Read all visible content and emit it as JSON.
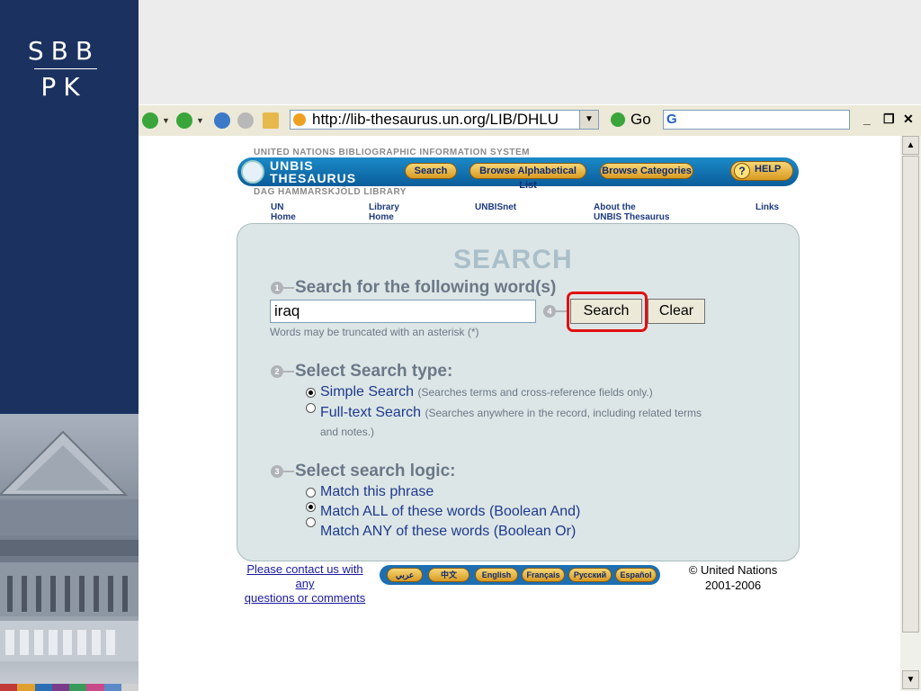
{
  "sidebar": {
    "logo_top": "SBB",
    "logo_bottom": "PK",
    "strip_colors": [
      "#c23b3b",
      "#e0a030",
      "#2b6fb3",
      "#7a3c8a",
      "#3a9a5a",
      "#c84a8a",
      "#5a8ac8",
      "#d0d0d0"
    ]
  },
  "browser": {
    "address": "http://lib-thesaurus.un.org/LIB/DHLU",
    "go_label": "Go",
    "search_value": ""
  },
  "unbis": {
    "system_label": "UNITED NATIONS BIBLIOGRAPHIC INFORMATION SYSTEM",
    "title_line1": "UNBIS",
    "title_line2": "THESAURUS",
    "library_label": "DAG HAMMARSKJÖLD LIBRARY",
    "buttons": {
      "search": "Search",
      "browse_alpha": "Browse Alphabetical List",
      "browse_cat": "Browse Categories",
      "help": "HELP"
    },
    "nav": {
      "un_home_1": "UN",
      "un_home_2": "Home",
      "lib_home_1": "Library",
      "lib_home_2": "Home",
      "unbisnet": "UNBISnet",
      "about_1": "About the",
      "about_2": "UNBIS Thesaurus",
      "links": "Links"
    }
  },
  "search": {
    "heading": "SEARCH",
    "step1_num": "1",
    "step1_title": "Search for the following word(s)",
    "query": "iraq",
    "step4_num": "4",
    "search_button": "Search",
    "clear_button": "Clear",
    "trunc_hint": "Words may be truncated with an asterisk (*)",
    "step2_num": "2",
    "step2_title": "Select Search type:",
    "type_simple": "Simple Search",
    "type_simple_note": "(Searches terms and cross-reference fields only.)",
    "type_full": "Full-text Search",
    "type_full_note": "(Searches anywhere in the record, including related terms",
    "type_full_note2": "and notes.)",
    "selected_type": "simple",
    "step3_num": "3",
    "step3_title": "Select search logic:",
    "logic_phrase": "Match this phrase",
    "logic_all": "Match ALL of these words (Boolean And)",
    "logic_any": "Match ANY of these words (Boolean Or)",
    "selected_logic": "all"
  },
  "footer": {
    "contact_1": "Please contact us with",
    "contact_2": "any",
    "contact_3": "questions or comments",
    "langs": [
      "عربي",
      "中文",
      "English",
      "Français",
      "Русский",
      "Español"
    ],
    "copyright_1": "© United Nations",
    "copyright_2": "2001-2006"
  },
  "colors": {
    "sidebar_bg": "#1b3260",
    "banner_blue": "#0a5d9a",
    "panel_bg": "#dde6e6",
    "highlight_red": "#e01010"
  }
}
